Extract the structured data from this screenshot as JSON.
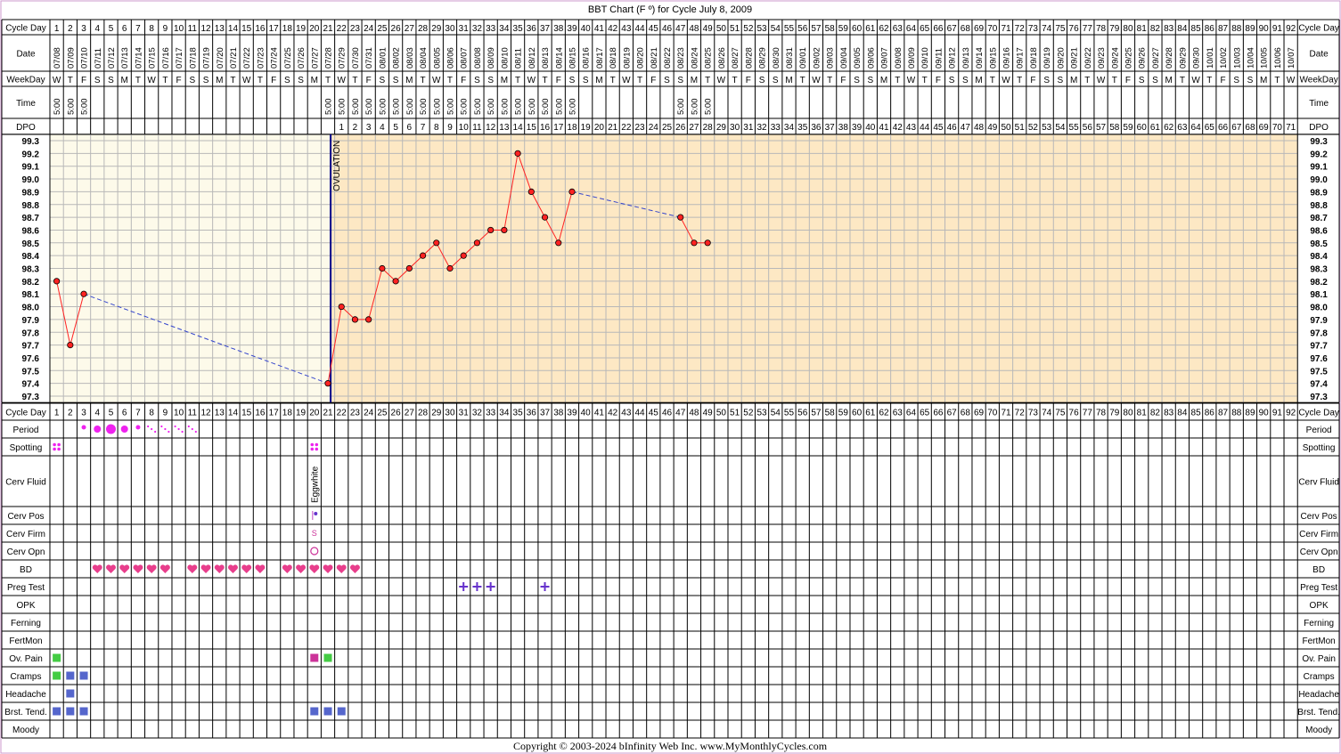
{
  "title": "BBT Chart (F º) for Cycle July 8, 2009",
  "copyright": "Copyright © 2003-2024 bInfinity Web Inc.      www.MyMonthlyCycles.com",
  "labels": {
    "cycle_day": "Cycle Day",
    "date": "Date",
    "weekday": "WeekDay",
    "time": "Time",
    "dpo": "DPO",
    "ovulation": "OVULATION",
    "period": "Period",
    "spotting": "Spotting",
    "cerv_fluid": "Cerv Fluid",
    "cerv_pos": "Cerv Pos",
    "cerv_firm": "Cerv Firm",
    "cerv_opn": "Cerv Opn",
    "bd": "BD",
    "preg_test": "Preg Test",
    "opk": "OPK",
    "ferning": "Ferning",
    "fertmon": "FertMon",
    "ov_pain": "Ov. Pain",
    "cramps": "Cramps",
    "headache": "Headache",
    "brst_tend": "Brst. Tend.",
    "moody": "Moody"
  },
  "colors": {
    "pre_ovulation_bg": "#fdfaea",
    "post_ovulation_bg": "#fde8c4",
    "temp_line": "#ff2222",
    "temp_point": "#ff2222",
    "dashed_line": "#3344cc",
    "ovulation_line": "#00008b",
    "period": "#ee22ee",
    "bd_heart": "#e83e8c",
    "preg_test": "#6633cc",
    "ov_pain_pink": "#cc3399",
    "green": "#44cc44",
    "blue": "#5566cc",
    "frame": "#cc99cc"
  },
  "chart_data": {
    "type": "line",
    "cycle_days": [
      1,
      2,
      3,
      4,
      5,
      6,
      7,
      8,
      9,
      10,
      11,
      12,
      13,
      14,
      15,
      16,
      17,
      18,
      19,
      20,
      21,
      22,
      23,
      24,
      25,
      26,
      27,
      28,
      29,
      30,
      31,
      32,
      33,
      34,
      35,
      36,
      37,
      38,
      39,
      40,
      41,
      42,
      43,
      44,
      45,
      46,
      47,
      48,
      49,
      50,
      51,
      52,
      53,
      54,
      55,
      56,
      57,
      58,
      59,
      60,
      61,
      62,
      63,
      64,
      65,
      66,
      67,
      68,
      69,
      70,
      71,
      72,
      73,
      74,
      75,
      76,
      77,
      78,
      79,
      80,
      81,
      82,
      83,
      84,
      85,
      86,
      87,
      88,
      89,
      90,
      91,
      92
    ],
    "dates": [
      "07/08",
      "07/09",
      "07/10",
      "07/11",
      "07/12",
      "07/13",
      "07/14",
      "07/15",
      "07/16",
      "07/17",
      "07/18",
      "07/19",
      "07/20",
      "07/21",
      "07/22",
      "07/23",
      "07/24",
      "07/25",
      "07/26",
      "07/27",
      "07/28",
      "07/29",
      "07/30",
      "07/31",
      "08/01",
      "08/02",
      "08/03",
      "08/04",
      "08/05",
      "08/06",
      "08/07",
      "08/08",
      "08/09",
      "08/10",
      "08/11",
      "08/12",
      "08/13",
      "08/14",
      "08/15",
      "08/16",
      "08/17",
      "08/18",
      "08/19",
      "08/20",
      "08/21",
      "08/22",
      "08/23",
      "08/24",
      "08/25",
      "08/26",
      "08/27",
      "08/28",
      "08/29",
      "08/30",
      "08/31",
      "09/01",
      "09/02",
      "09/03",
      "09/04",
      "09/05",
      "09/06",
      "09/07",
      "09/08",
      "09/09",
      "09/10",
      "09/11",
      "09/12",
      "09/13",
      "09/14",
      "09/15",
      "09/16",
      "09/17",
      "09/18",
      "09/19",
      "09/20",
      "09/21",
      "09/22",
      "09/23",
      "09/24",
      "09/25",
      "09/26",
      "09/27",
      "09/28",
      "09/29",
      "09/30",
      "10/01",
      "10/02",
      "10/03",
      "10/04",
      "10/05",
      "10/06",
      "10/07"
    ],
    "weekdays": [
      "W",
      "T",
      "F",
      "S",
      "S",
      "M",
      "T",
      "W",
      "T",
      "F",
      "S",
      "S",
      "M",
      "T",
      "W",
      "T",
      "F",
      "S",
      "S",
      "M",
      "T",
      "W",
      "T",
      "F",
      "S",
      "S",
      "M",
      "T",
      "W",
      "T",
      "F",
      "S",
      "S",
      "M",
      "T",
      "W",
      "T",
      "F",
      "S",
      "S",
      "M",
      "T",
      "W",
      "T",
      "F",
      "S",
      "S",
      "M",
      "T",
      "W",
      "T",
      "F",
      "S",
      "S",
      "M",
      "T",
      "W",
      "T",
      "F",
      "S",
      "S",
      "M",
      "T",
      "W",
      "T",
      "F",
      "S",
      "S",
      "M",
      "T",
      "W",
      "T",
      "F",
      "S",
      "S",
      "M",
      "T",
      "W",
      "T",
      "F",
      "S",
      "S",
      "M",
      "T",
      "W",
      "T",
      "F",
      "S",
      "S",
      "M",
      "T",
      "W"
    ],
    "times": [
      "5:00",
      "5:00",
      "5:00",
      "",
      "",
      "",
      "",
      "",
      "",
      "",
      "",
      "",
      "",
      "",
      "",
      "",
      "",
      "",
      "",
      "",
      "5:00",
      "5:00",
      "5:00",
      "5:00",
      "5:00",
      "5:00",
      "5:00",
      "5:00",
      "5:00",
      "5:00",
      "5:00",
      "5:00",
      "5:00",
      "5:00",
      "5:00",
      "5:00",
      "5:00",
      "5:00",
      "5:00",
      "",
      "",
      "",
      "",
      "",
      "",
      "",
      "5:00",
      "5:00",
      "5:00",
      "",
      "",
      "",
      "",
      "",
      "",
      "",
      "",
      "",
      "",
      "",
      "",
      "",
      "",
      "",
      "",
      "",
      "",
      "",
      "",
      "",
      "",
      "",
      "",
      "",
      "",
      "",
      "",
      "",
      "",
      "",
      "",
      "",
      "",
      "",
      "",
      "",
      "",
      "",
      "",
      "",
      ""
    ],
    "dpo": [
      "",
      "",
      "",
      "",
      "",
      "",
      "",
      "",
      "",
      "",
      "",
      "",
      "",
      "",
      "",
      "",
      "",
      "",
      "",
      "",
      "",
      "1",
      "2",
      "3",
      "4",
      "5",
      "6",
      "7",
      "8",
      "9",
      "10",
      "11",
      "12",
      "13",
      "14",
      "15",
      "16",
      "17",
      "18",
      "19",
      "20",
      "21",
      "22",
      "23",
      "24",
      "25",
      "26",
      "27",
      "28",
      "29",
      "30",
      "31",
      "32",
      "33",
      "34",
      "35",
      "36",
      "37",
      "38",
      "39",
      "40",
      "41",
      "42",
      "43",
      "44",
      "45",
      "46",
      "47",
      "48",
      "49",
      "50",
      "51",
      "52",
      "53",
      "54",
      "55",
      "56",
      "57",
      "58",
      "59",
      "60",
      "61",
      "62",
      "63",
      "64",
      "65",
      "66",
      "67",
      "68",
      "69",
      "70",
      "71"
    ],
    "temperatures": [
      98.2,
      97.7,
      98.1,
      null,
      null,
      null,
      null,
      null,
      null,
      null,
      null,
      null,
      null,
      null,
      null,
      null,
      null,
      null,
      null,
      null,
      97.4,
      98.0,
      97.9,
      97.9,
      98.3,
      98.2,
      98.3,
      98.4,
      98.5,
      98.3,
      98.4,
      98.5,
      98.6,
      98.6,
      99.2,
      98.9,
      98.7,
      98.5,
      98.9,
      null,
      null,
      null,
      null,
      null,
      null,
      null,
      98.7,
      98.5,
      98.5
    ],
    "y_ticks": [
      "97.3",
      "97.4",
      "97.5",
      "97.6",
      "97.7",
      "97.8",
      "97.9",
      "98.0",
      "98.1",
      "98.2",
      "98.3",
      "98.4",
      "98.5",
      "98.6",
      "98.7",
      "98.8",
      "98.9",
      "99.0",
      "99.1",
      "99.2",
      "99.3"
    ],
    "ylim": [
      97.3,
      99.3
    ],
    "ovulation_day": 21,
    "period": {
      "3": "light",
      "4": "medium",
      "5": "heavy",
      "6": "medium",
      "7": "light",
      "8": "spotting",
      "9": "spotting",
      "10": "spotting",
      "11": "spotting"
    },
    "spotting_days": [
      1,
      20
    ],
    "cerv_fluid": {
      "20": "Eggwhite"
    },
    "cerv_pos_days": [
      20
    ],
    "cerv_firm": {
      "20": "S"
    },
    "cerv_opn_days": [
      20
    ],
    "bd_days": [
      4,
      5,
      6,
      7,
      8,
      9,
      11,
      12,
      13,
      14,
      15,
      16,
      18,
      19,
      20,
      21,
      22,
      23
    ],
    "preg_test_days": [
      31,
      32,
      33,
      37
    ],
    "ov_pain": {
      "1": "green",
      "20": "pink",
      "21": "green"
    },
    "cramps": {
      "1": "green",
      "2": "blue",
      "3": "blue"
    },
    "headache_days": [
      2
    ],
    "brst_tend_days": [
      1,
      2,
      3,
      20,
      21,
      22
    ]
  }
}
